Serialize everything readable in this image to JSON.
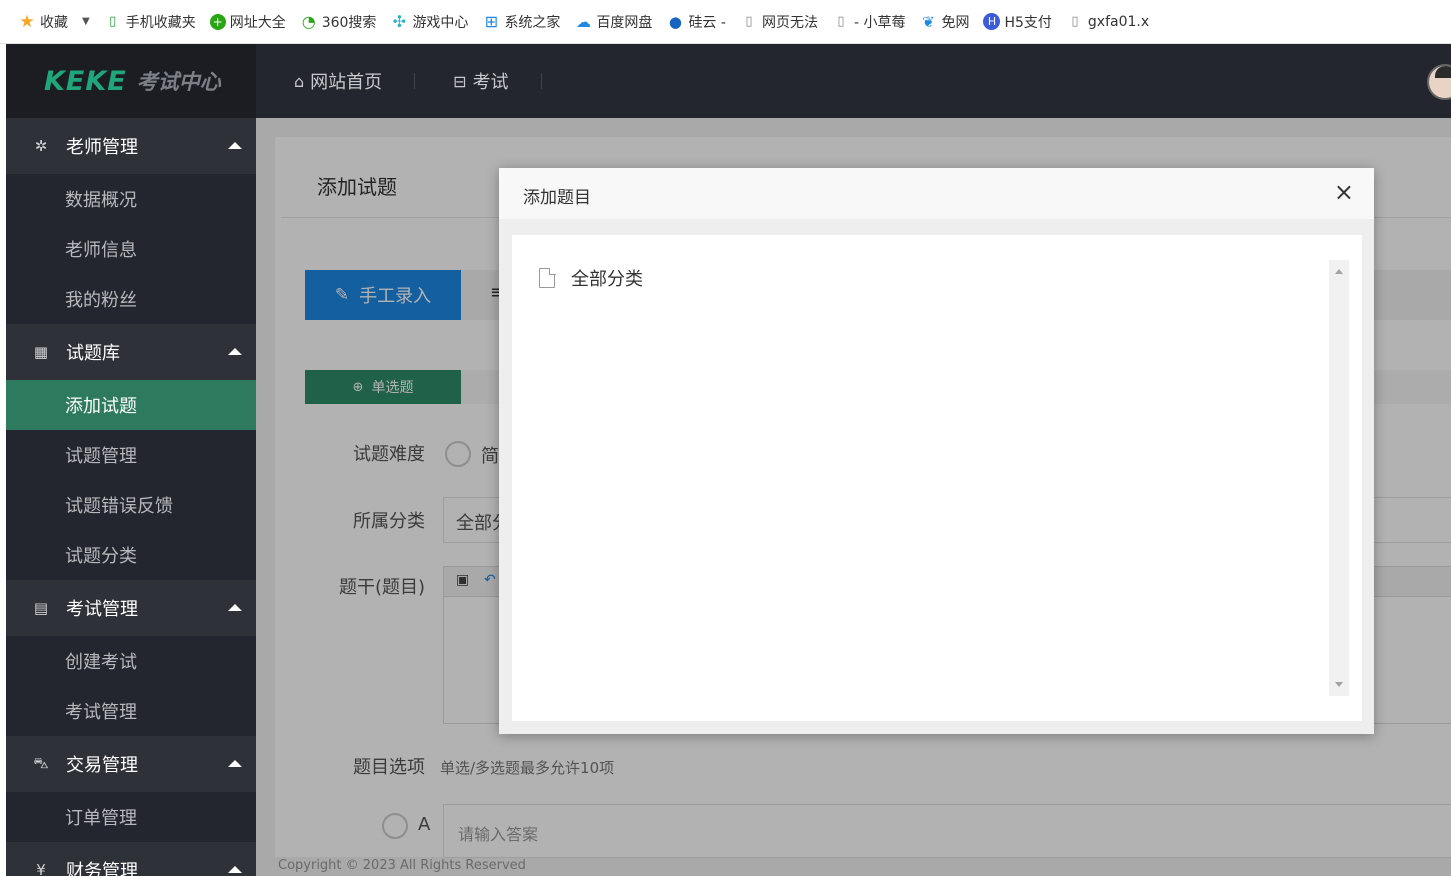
{
  "bookmarks": [
    {
      "label": "收藏",
      "icon": "star-icon",
      "color": "#f5a623"
    },
    {
      "label": "手机收藏夹",
      "icon": "phone-icon",
      "color": "#2a9d3c"
    },
    {
      "label": "网址大全",
      "icon": "plus-circle-icon",
      "color": "#2aa515"
    },
    {
      "label": "360搜索",
      "icon": "search-360-icon",
      "color": "#2aa515"
    },
    {
      "label": "游戏中心",
      "icon": "gamepad-icon",
      "color": "#2bb1c5"
    },
    {
      "label": "系统之家",
      "icon": "windows-icon",
      "color": "#1e88e5"
    },
    {
      "label": "百度网盘",
      "icon": "cloud-icon",
      "color": "#1e88e5"
    },
    {
      "label": "硅云 -",
      "icon": "blue-cloud-icon",
      "color": "#1565c0"
    },
    {
      "label": "网页无法",
      "icon": "page-icon",
      "color": "#888888"
    },
    {
      "label": "- 小草莓",
      "icon": "page-icon",
      "color": "#888888"
    },
    {
      "label": "免网",
      "icon": "leaf-icon",
      "color": "#1e88e5"
    },
    {
      "label": "H5支付",
      "icon": "h-circle-icon",
      "color": "#3b5bdb"
    },
    {
      "label": "gxfa01.x",
      "icon": "page-icon",
      "color": "#888888"
    }
  ],
  "header": {
    "logo_main": "KEKE",
    "logo_sub": "考试中心",
    "nav": [
      {
        "label": "网站首页",
        "icon": "home-icon"
      },
      {
        "label": "考试",
        "icon": "exam-icon"
      }
    ]
  },
  "sidebar": {
    "groups": [
      {
        "label": "老师管理",
        "icon": "gear-icon",
        "items": [
          {
            "label": "数据概况",
            "active": false
          },
          {
            "label": "老师信息",
            "active": false
          },
          {
            "label": "我的粉丝",
            "active": false
          }
        ]
      },
      {
        "label": "试题库",
        "icon": "grid-icon",
        "items": [
          {
            "label": "添加试题",
            "active": true
          },
          {
            "label": "试题管理",
            "active": false
          },
          {
            "label": "试题错误反馈",
            "active": false
          },
          {
            "label": "试题分类",
            "active": false
          }
        ]
      },
      {
        "label": "考试管理",
        "icon": "document-icon",
        "items": [
          {
            "label": "创建考试",
            "active": false
          },
          {
            "label": "考试管理",
            "active": false
          }
        ]
      },
      {
        "label": "交易管理",
        "icon": "cart-icon",
        "items": [
          {
            "label": "订单管理",
            "active": false
          }
        ]
      },
      {
        "label": "财务管理",
        "icon": "yen-icon",
        "items": []
      }
    ]
  },
  "page": {
    "title": "添加试题",
    "tab_manual": "手工录入",
    "tab_other_fragment": "≡",
    "type_single": "单选题",
    "difficulty_label": "试题难度",
    "difficulty_first": "简",
    "category_label": "所属分类",
    "category_value": "全部分",
    "stem_label": "题干(题目)",
    "options_label": "题目选项",
    "options_hint": "单选/多选题最多允许10项",
    "option_a_letter": "A",
    "option_a_placeholder": "请输入答案",
    "footer": "Copyright © 2023 All Rights Reserved"
  },
  "modal": {
    "title": "添加题目",
    "close": "×",
    "tree_items": [
      {
        "label": "全部分类",
        "icon": "file-icon"
      }
    ]
  },
  "colors": {
    "sidebar_bg": "#23262e",
    "active_green": "#2d7a5e",
    "primary_blue": "#1e88e5",
    "type_green": "#2e8b6a"
  }
}
